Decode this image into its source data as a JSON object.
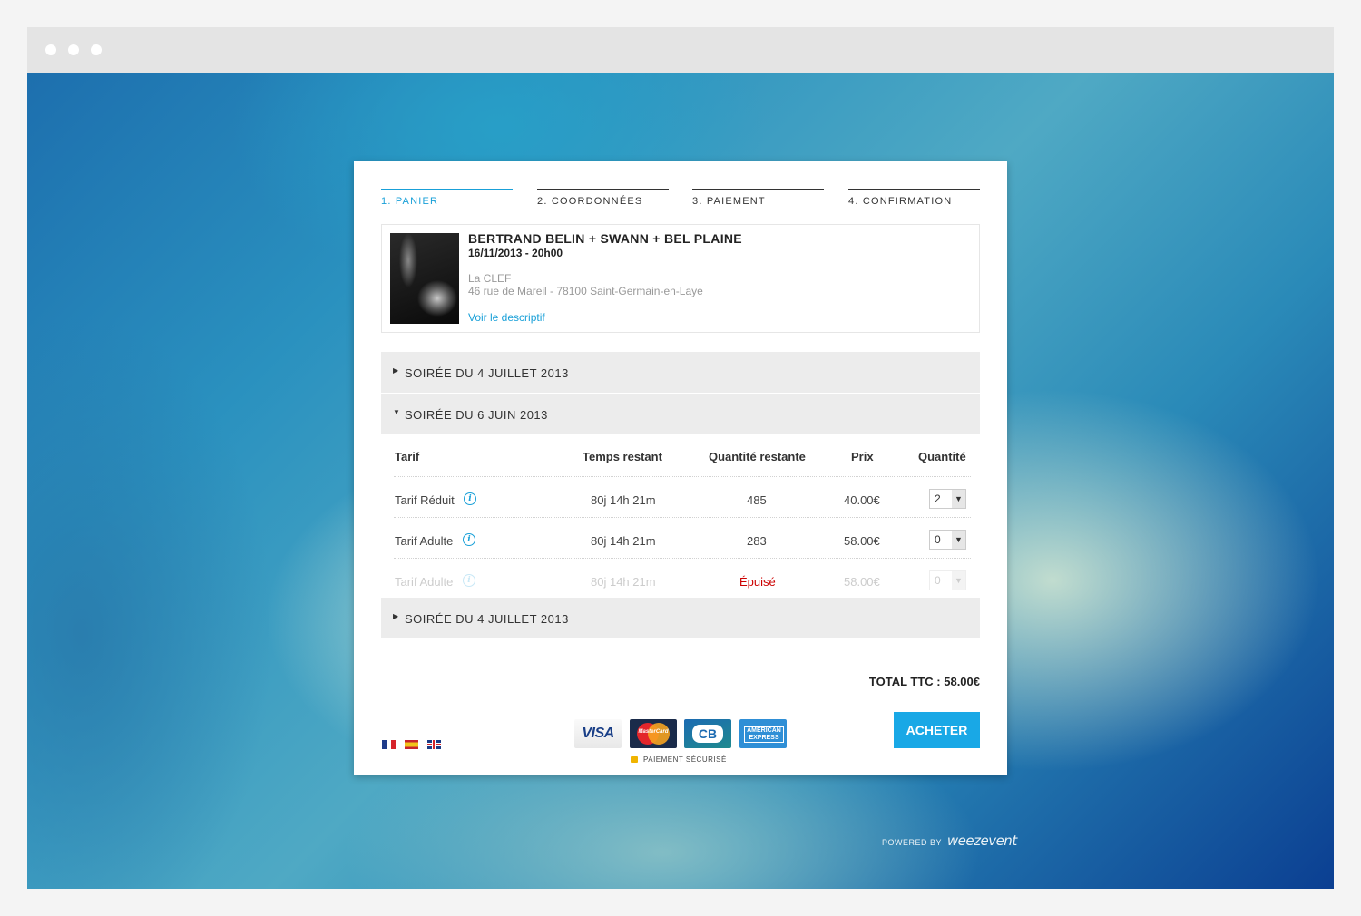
{
  "window": {
    "dots": [
      "",
      "",
      ""
    ]
  },
  "steps": [
    {
      "label": "1. PANIER",
      "active": true
    },
    {
      "label": "2. COORDONNÉES",
      "active": false
    },
    {
      "label": "3. PAIEMENT",
      "active": false
    },
    {
      "label": "4. CONFIRMATION",
      "active": false
    }
  ],
  "event": {
    "title": "BERTRAND BELIN + SWANN + BEL PLAINE",
    "datetime": "16/11/2013 - 20h00",
    "venue": "La CLEF",
    "address": "46 rue de Mareil - 78100 Saint-Germain-en-Laye",
    "link": "Voir le descriptif"
  },
  "sessions": [
    {
      "label": "SOIRÉE DU 4 JUILLET 2013",
      "expanded": false
    },
    {
      "label": "SOIRÉE DU 6 JUIN 2013",
      "expanded": true
    },
    {
      "label": "SOIRÉE DU 4 JUILLET 2013",
      "expanded": false
    }
  ],
  "table": {
    "headers": {
      "tarif": "Tarif",
      "temps": "Temps restant",
      "quantite_restante": "Quantité restante",
      "prix": "Prix",
      "quantite": "Quantité"
    },
    "rows": [
      {
        "tarif": "Tarif Réduit",
        "temps": "80j 14h 21m",
        "restante": "485",
        "prix": "40.00€",
        "qty": "2",
        "disabled": false
      },
      {
        "tarif": "Tarif Adulte",
        "temps": "80j 14h 21m",
        "restante": "283",
        "prix": "58.00€",
        "qty": "0",
        "disabled": false
      },
      {
        "tarif": "Tarif Adulte",
        "temps": "80j 14h 21m",
        "restante": "Épuisé",
        "prix": "58.00€",
        "qty": "0",
        "disabled": true
      }
    ]
  },
  "total": "TOTAL TTC : 58.00€",
  "languages": [
    "fr",
    "es",
    "en"
  ],
  "payment": {
    "cards": {
      "visa": "VISA",
      "mastercard": "MasterCard",
      "cb": "CB",
      "amex": "AMERICAN EXPRESS"
    },
    "secure": "PAIEMENT SÉCURISÉ"
  },
  "buy_button": "ACHETER",
  "powered": {
    "prefix": "POWERED BY",
    "brand": "weezevent"
  },
  "colors": {
    "accent": "#19a0d8",
    "button": "#19a8e6",
    "soldout": "#cc0000"
  }
}
